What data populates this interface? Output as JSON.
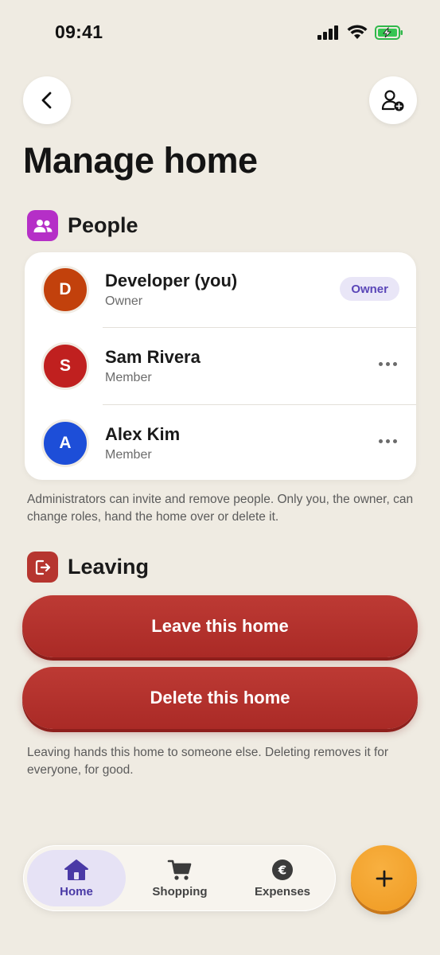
{
  "status_bar": {
    "time": "09:41"
  },
  "header": {
    "title": "Manage home"
  },
  "people": {
    "title": "People",
    "members": [
      {
        "initial": "D",
        "name": "Developer (you)",
        "role": "Owner",
        "badge": "Owner",
        "avatar_color": "#c2410c"
      },
      {
        "initial": "S",
        "name": "Sam Rivera",
        "role": "Member",
        "avatar_color": "#c0201f"
      },
      {
        "initial": "A",
        "name": "Alex Kim",
        "role": "Member",
        "avatar_color": "#1d4ed8"
      }
    ],
    "help": "Administrators can invite and remove people. Only you, the owner, can change roles, hand the home over or delete it."
  },
  "leaving": {
    "title": "Leaving",
    "leave_label": "Leave this home",
    "delete_label": "Delete this home",
    "help": "Leaving hands this home to someone else. Deleting removes it for everyone, for good."
  },
  "tabs": [
    {
      "label": "Home",
      "icon": "house-icon",
      "active": true
    },
    {
      "label": "Shopping",
      "icon": "cart-icon"
    },
    {
      "label": "Expenses",
      "icon": "euro-icon"
    }
  ],
  "fab": {
    "icon": "plus-icon"
  },
  "colors": {
    "background": "#efebe2",
    "accent": "#4a3aa6",
    "danger": "#b52f2b",
    "fab": "#f5a331",
    "people_icon": "#b52fc7"
  }
}
